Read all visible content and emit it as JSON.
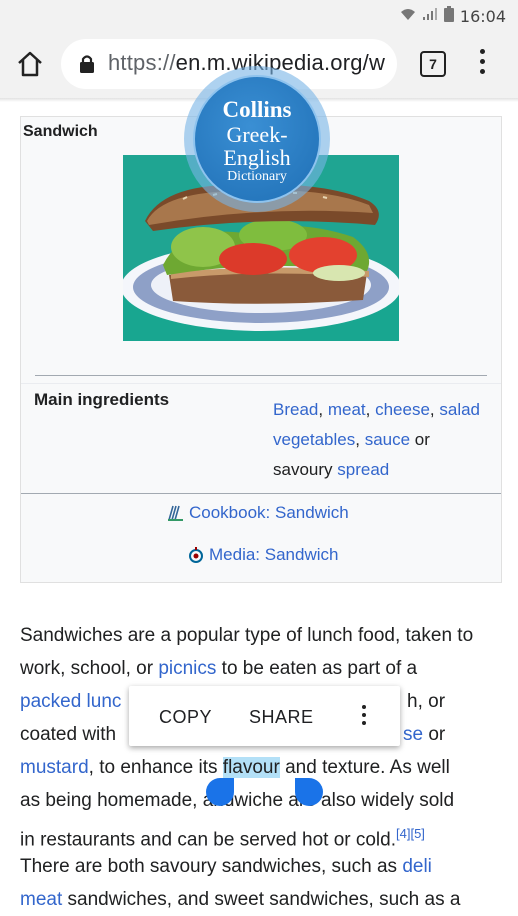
{
  "status_bar": {
    "time": "16:04"
  },
  "browser": {
    "url_prefix": "https://",
    "url_host": "en.m.wikipedia.org/w",
    "tab_count": "7"
  },
  "infobox": {
    "title": "Sandwich",
    "ingredients_label": "Main ingredients",
    "ingredients": {
      "bread": "Bread",
      "meat": "meat",
      "cheese": "cheese",
      "salad": "salad",
      "vegetables": "vegetables",
      "sauce": "sauce",
      "or": "or",
      "savoury": "savoury",
      "spread": "spread"
    },
    "cookbook_link": "Cookbook: Sandwich",
    "media_link": "Media: Sandwich"
  },
  "article": {
    "l1": "Sandwiches are a popular type of lunch food, taken to",
    "l2a": "work, school, or ",
    "l2_link": "picnics",
    "l2b": " to be eaten as part of a",
    "l3_link": "packed lunc",
    "l3b": "h, or",
    "l4a": "coated with",
    "l4_link": "se",
    "l4b": " or",
    "l5_link": "mustard",
    "l5a": ", to enhance its ",
    "l5_sel": "flavour",
    "l5b": " and texture. As well",
    "l6a": "as being homemade, ",
    "l6b": "andwiche",
    "l6c": " are also widely sold",
    "l7": "in restaurants and can be served hot or cold.",
    "l7_ref": "[4][5]",
    "l8a": "There are both savoury sandwiches, such as ",
    "l8_link": "deli",
    "l9_link": "meat",
    "l9b": " sandwiches, and sweet sandwiches, such as a"
  },
  "context_menu": {
    "copy": "COPY",
    "share": "SHARE"
  },
  "collins_bubble": {
    "line1": "Collins",
    "line2": "Greek-",
    "line3": "English",
    "line4": "Dictionary"
  }
}
